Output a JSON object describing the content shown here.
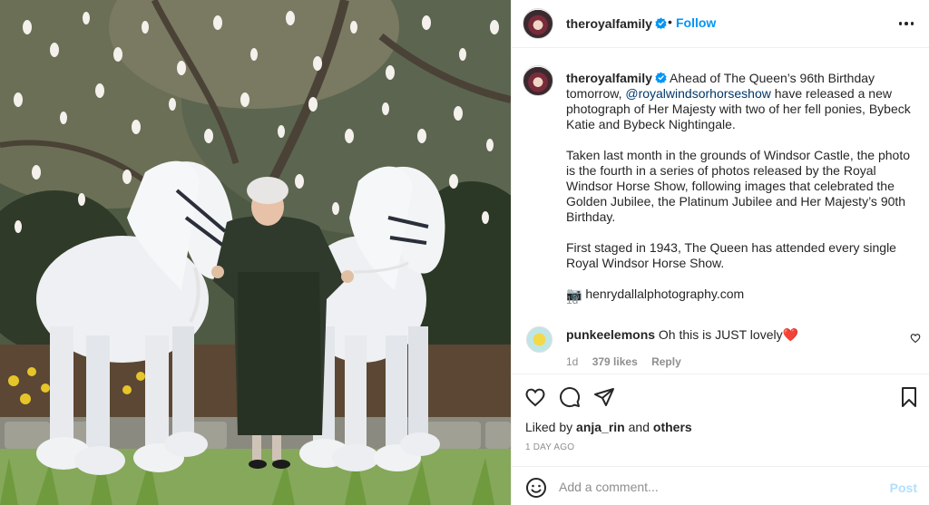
{
  "post": {
    "image_alt": "The Queen standing between two white fell ponies in front of a blossoming magnolia tree"
  },
  "header": {
    "username": "theroyalfamily",
    "separator": "•",
    "follow_label": "Follow",
    "more_icon": "more-horizontal-icon"
  },
  "caption": {
    "username": "theroyalfamily",
    "text_before_mention": " Ahead of The Queen’s 96th Birthday tomorrow, ",
    "mention": "@royalwindsorhorseshow",
    "text_after_mention": " have released a new photograph of Her Majesty with two of her fell ponies, Bybeck Katie and Bybeck Nightingale.",
    "paragraph2": "Taken last month in the grounds of Windsor Castle, the photo is the fourth in a series of photos released by the Royal Windsor Horse Show, following images that celebrated the Golden Jubilee, the Platinum Jubilee and Her Majesty’s 90th Birthday.",
    "paragraph3": "First staged in 1943, The Queen has attended every single Royal Windsor Horse Show.",
    "credit": "📷 henrydallalphotography.com",
    "timestamp": "1d"
  },
  "comment": {
    "username": "punkeelemons",
    "text": " Oh this is JUST lovely",
    "emoji": "❤️",
    "time": "1d",
    "likes": "379 likes",
    "reply_label": "Reply"
  },
  "likes": {
    "prefix": "Liked by ",
    "user": "anja_rin",
    "middle": " and ",
    "others": "others"
  },
  "post_time": "1 DAY AGO",
  "add_comment": {
    "placeholder": "Add a comment...",
    "post_label": "Post"
  },
  "colors": {
    "accent": "#0095f6",
    "mention": "#00376b",
    "post_disabled": "#b2dffc",
    "secondary_text": "#8e8e8e"
  }
}
